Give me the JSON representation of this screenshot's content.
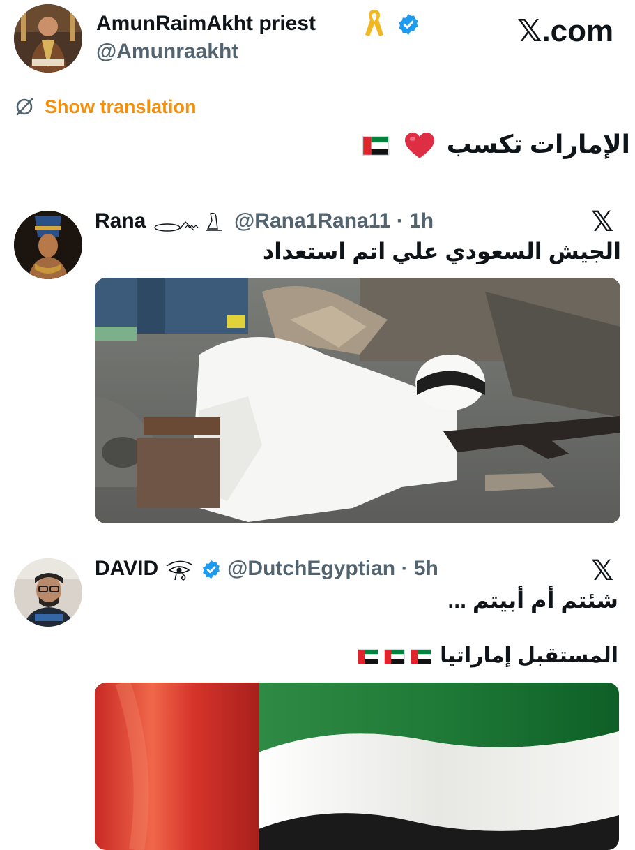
{
  "main_post": {
    "display_name": "AmunRaimAkht priest",
    "handle": "@Amunraakht",
    "site_label": "𝕏.com",
    "show_translation": "Show translation",
    "text": "الإمارات تكسب",
    "flag_count": 1,
    "icons": [
      "yellow-ribbon-icon",
      "verified-badge-icon",
      "heart-emoji-icon",
      "uae-flag-icon"
    ],
    "colors": {
      "translation": "#f4900c",
      "verified": "#1d9bf0",
      "heart": "#e0245e"
    }
  },
  "quote1": {
    "display_name": "Rana",
    "handle": "@Rana1Rana11",
    "time": "· 1h",
    "text": "الجيش السعودي علي اتم استعداد",
    "x_logo": "𝕏",
    "icons": [
      "hieroglyph-name-decoration-icon"
    ]
  },
  "quote2": {
    "display_name": "DAVID",
    "handle": "@DutchEgyptian",
    "time": "· 5h",
    "text_line1": "شئتم أم أبيتم ...",
    "text_line2": "المستقبل إماراتيا",
    "flag_count": 3,
    "x_logo": "𝕏",
    "icons": [
      "eye-of-horus-icon",
      "verified-badge-icon",
      "uae-flag-icon"
    ]
  },
  "colors": {
    "uae_red": "#e0242b",
    "uae_green": "#00843d",
    "uae_black": "#111111"
  }
}
